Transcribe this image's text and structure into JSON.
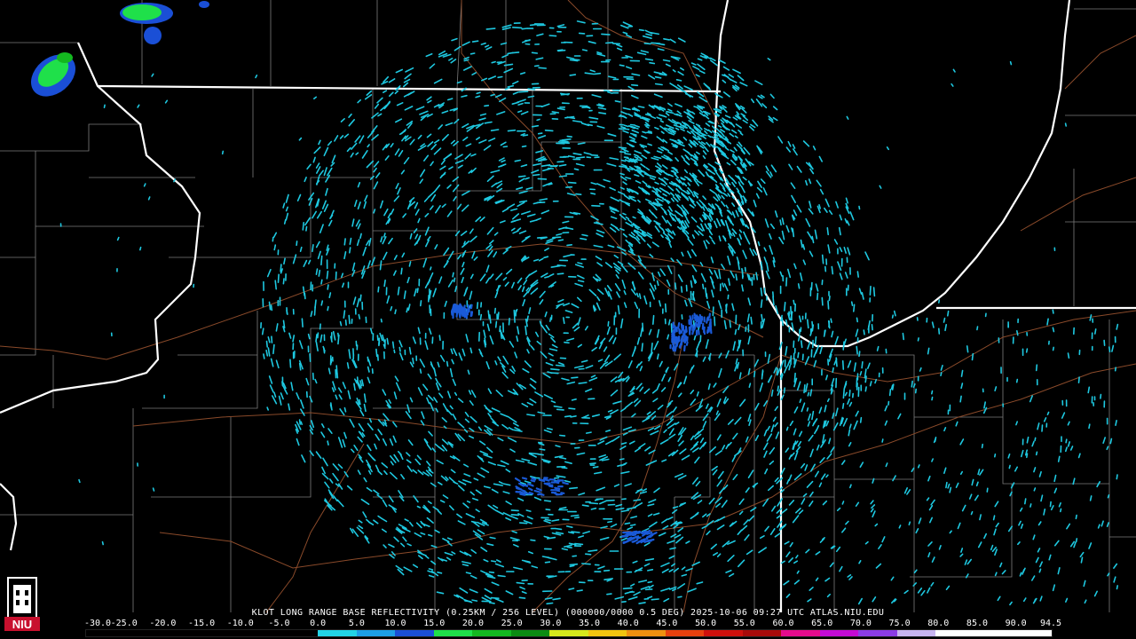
{
  "product": {
    "caption": "KLOT LONG RANGE BASE REFLECTIVITY (0.25KM / 256 LEVEL) (000000/0000 0.5 DEG) 2025-10-06 09:27 UTC  ATLAS.NIU.EDU"
  },
  "logo": {
    "text": "NIU",
    "color": "#c8102e"
  },
  "legend": {
    "unit": "",
    "ticks": [
      "-30.0",
      "-25.0",
      "-20.0",
      "-15.0",
      "-10.0",
      "-5.0",
      "0.0",
      "5.0",
      "10.0",
      "15.0",
      "20.0",
      "25.0",
      "30.0",
      "35.0",
      "40.0",
      "45.0",
      "50.0",
      "55.0",
      "60.0",
      "65.0",
      "70.0",
      "75.0",
      "80.0",
      "85.0",
      "90.0",
      "94.5"
    ],
    "tick_values": [
      -30,
      -25,
      -20,
      -15,
      -10,
      -5,
      0,
      5,
      10,
      15,
      20,
      25,
      30,
      35,
      40,
      45,
      50,
      55,
      60,
      65,
      70,
      75,
      80,
      85,
      90,
      94.5
    ],
    "range": [
      -30,
      94.5
    ],
    "colors": [
      {
        "from": -30,
        "to": 0,
        "color": "#000000"
      },
      {
        "from": 0,
        "to": 5,
        "color": "#23d3e6"
      },
      {
        "from": 5,
        "to": 10,
        "color": "#1e9ee6"
      },
      {
        "from": 10,
        "to": 15,
        "color": "#1a4fd6"
      },
      {
        "from": 15,
        "to": 20,
        "color": "#1fe04a"
      },
      {
        "from": 20,
        "to": 25,
        "color": "#14b820"
      },
      {
        "from": 25,
        "to": 30,
        "color": "#0c8c12"
      },
      {
        "from": 30,
        "to": 35,
        "color": "#d6e81c"
      },
      {
        "from": 35,
        "to": 40,
        "color": "#f2c410"
      },
      {
        "from": 40,
        "to": 45,
        "color": "#f09010"
      },
      {
        "from": 45,
        "to": 50,
        "color": "#e8400e"
      },
      {
        "from": 50,
        "to": 55,
        "color": "#d0100c"
      },
      {
        "from": 55,
        "to": 60,
        "color": "#a80a0a"
      },
      {
        "from": 60,
        "to": 65,
        "color": "#e60a8c"
      },
      {
        "from": 65,
        "to": 70,
        "color": "#c40ad4"
      },
      {
        "from": 70,
        "to": 75,
        "color": "#8c3ce6"
      },
      {
        "from": 75,
        "to": 80,
        "color": "#c8b4f0"
      },
      {
        "from": 80,
        "to": 94.5,
        "color": "#ffffff"
      }
    ]
  },
  "map_colors": {
    "state_border": "#ffffff",
    "county_border": "#7c7c7c",
    "highway": "#8a4a2a",
    "echo_clear_air": "#1ec8e0",
    "echo_light": "#1a5ad8",
    "echo_moderate": "#1ee04a"
  }
}
